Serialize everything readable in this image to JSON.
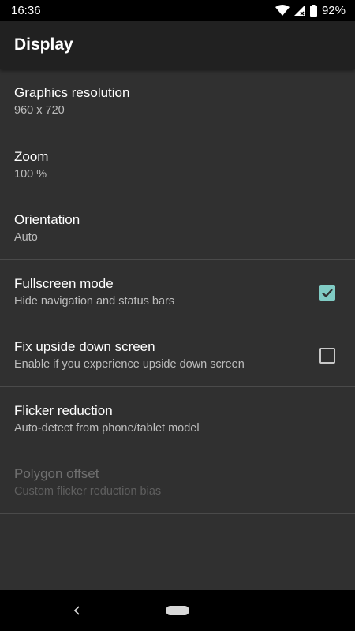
{
  "status_bar": {
    "time": "16:36",
    "battery": "92%",
    "icons": [
      "wifi-icon",
      "cellular-signal-icon",
      "battery-icon"
    ]
  },
  "app_bar": {
    "title": "Display"
  },
  "preferences": [
    {
      "title": "Graphics resolution",
      "summary": "960 x 720"
    },
    {
      "title": "Zoom",
      "summary": "100 %"
    },
    {
      "title": "Orientation",
      "summary": "Auto"
    },
    {
      "title": "Fullscreen mode",
      "summary": "Hide navigation and status bars",
      "checked": true
    },
    {
      "title": "Fix upside down screen",
      "summary": "Enable if you experience upside down screen",
      "checked": false
    },
    {
      "title": "Flicker reduction",
      "summary": "Auto-detect from phone/tablet model"
    },
    {
      "title": "Polygon offset",
      "summary": "Custom flicker reduction bias",
      "enabled": false
    }
  ],
  "nav_bar": {
    "icons": [
      "back-icon",
      "home-pill-icon"
    ]
  },
  "colors": {
    "background": "#303030",
    "app_bar": "#212121",
    "accent": "#80cbc4",
    "divider": "#4a4a4a"
  }
}
